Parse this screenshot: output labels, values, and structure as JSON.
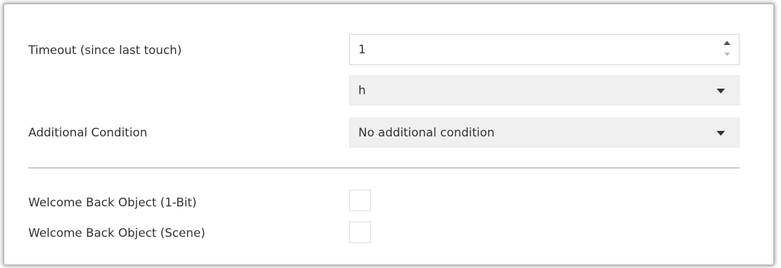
{
  "form": {
    "timeout": {
      "label": "Timeout (since last touch)",
      "value": "1"
    },
    "timeout_unit": {
      "value": "h"
    },
    "additional_condition": {
      "label": "Additional Condition",
      "value": "No additional condition"
    },
    "welcome_back_1bit": {
      "label": "Welcome Back Object (1-Bit)",
      "checked": false
    },
    "welcome_back_scene": {
      "label": "Welcome Back Object (Scene)",
      "checked": false
    }
  },
  "icons": {
    "spin_up": "chevron-up-icon",
    "spin_down": "chevron-down-icon",
    "dropdown": "caret-down-icon"
  },
  "colors": {
    "text": "#333333",
    "select_background": "#f0f0f0",
    "border": "#d6d6d6",
    "divider": "#9b9b9b"
  }
}
